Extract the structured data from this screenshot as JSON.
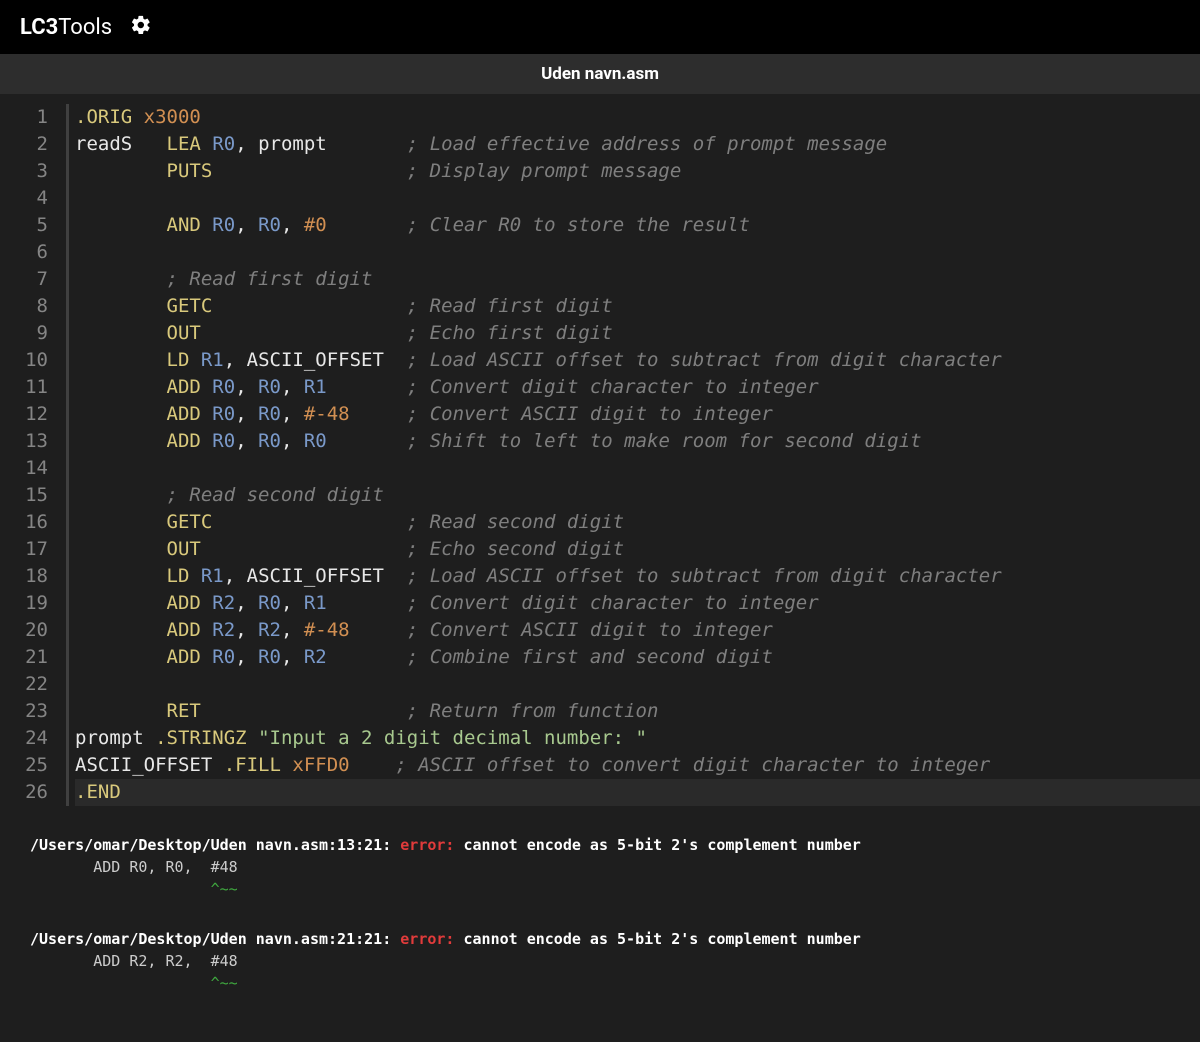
{
  "app": {
    "title_bold": "LC3",
    "title_rest": "Tools"
  },
  "tab": {
    "filename": "Uden navn.asm"
  },
  "editor": {
    "line_count": 26,
    "active_line": 26,
    "lines": [
      [
        {
          "cls": "tk-directive",
          "t": ".ORIG"
        },
        {
          "cls": "",
          "t": " "
        },
        {
          "cls": "tk-number",
          "t": "x3000"
        }
      ],
      [
        {
          "cls": "tk-label",
          "t": "readS"
        },
        {
          "cls": "",
          "t": "   "
        },
        {
          "cls": "tk-opcode",
          "t": "LEA"
        },
        {
          "cls": "",
          "t": " "
        },
        {
          "cls": "tk-register",
          "t": "R0"
        },
        {
          "cls": "tk-punct",
          "t": ", "
        },
        {
          "cls": "tk-label",
          "t": "prompt"
        },
        {
          "cls": "",
          "t": "       "
        },
        {
          "cls": "tk-comment",
          "t": "; Load effective address of prompt message"
        }
      ],
      [
        {
          "cls": "",
          "t": "        "
        },
        {
          "cls": "tk-opcode",
          "t": "PUTS"
        },
        {
          "cls": "",
          "t": "                 "
        },
        {
          "cls": "tk-comment",
          "t": "; Display prompt message"
        }
      ],
      [],
      [
        {
          "cls": "",
          "t": "        "
        },
        {
          "cls": "tk-opcode",
          "t": "AND"
        },
        {
          "cls": "",
          "t": " "
        },
        {
          "cls": "tk-register",
          "t": "R0"
        },
        {
          "cls": "tk-punct",
          "t": ", "
        },
        {
          "cls": "tk-register",
          "t": "R0"
        },
        {
          "cls": "tk-punct",
          "t": ", "
        },
        {
          "cls": "tk-number",
          "t": "#0"
        },
        {
          "cls": "",
          "t": "       "
        },
        {
          "cls": "tk-comment",
          "t": "; Clear R0 to store the result"
        }
      ],
      [],
      [
        {
          "cls": "",
          "t": "        "
        },
        {
          "cls": "tk-comment",
          "t": "; Read first digit"
        }
      ],
      [
        {
          "cls": "",
          "t": "        "
        },
        {
          "cls": "tk-opcode",
          "t": "GETC"
        },
        {
          "cls": "",
          "t": "                 "
        },
        {
          "cls": "tk-comment",
          "t": "; Read first digit"
        }
      ],
      [
        {
          "cls": "",
          "t": "        "
        },
        {
          "cls": "tk-opcode",
          "t": "OUT"
        },
        {
          "cls": "",
          "t": "                  "
        },
        {
          "cls": "tk-comment",
          "t": "; Echo first digit"
        }
      ],
      [
        {
          "cls": "",
          "t": "        "
        },
        {
          "cls": "tk-opcode",
          "t": "LD"
        },
        {
          "cls": "",
          "t": " "
        },
        {
          "cls": "tk-register",
          "t": "R1"
        },
        {
          "cls": "tk-punct",
          "t": ", "
        },
        {
          "cls": "tk-label",
          "t": "ASCII_OFFSET"
        },
        {
          "cls": "",
          "t": "  "
        },
        {
          "cls": "tk-comment",
          "t": "; Load ASCII offset to subtract from digit character"
        }
      ],
      [
        {
          "cls": "",
          "t": "        "
        },
        {
          "cls": "tk-opcode",
          "t": "ADD"
        },
        {
          "cls": "",
          "t": " "
        },
        {
          "cls": "tk-register",
          "t": "R0"
        },
        {
          "cls": "tk-punct",
          "t": ", "
        },
        {
          "cls": "tk-register",
          "t": "R0"
        },
        {
          "cls": "tk-punct",
          "t": ", "
        },
        {
          "cls": "tk-register",
          "t": "R1"
        },
        {
          "cls": "",
          "t": "       "
        },
        {
          "cls": "tk-comment",
          "t": "; Convert digit character to integer"
        }
      ],
      [
        {
          "cls": "",
          "t": "        "
        },
        {
          "cls": "tk-opcode",
          "t": "ADD"
        },
        {
          "cls": "",
          "t": " "
        },
        {
          "cls": "tk-register",
          "t": "R0"
        },
        {
          "cls": "tk-punct",
          "t": ", "
        },
        {
          "cls": "tk-register",
          "t": "R0"
        },
        {
          "cls": "tk-punct",
          "t": ", "
        },
        {
          "cls": "tk-number",
          "t": "#-48"
        },
        {
          "cls": "",
          "t": "     "
        },
        {
          "cls": "tk-comment",
          "t": "; Convert ASCII digit to integer"
        }
      ],
      [
        {
          "cls": "",
          "t": "        "
        },
        {
          "cls": "tk-opcode",
          "t": "ADD"
        },
        {
          "cls": "",
          "t": " "
        },
        {
          "cls": "tk-register",
          "t": "R0"
        },
        {
          "cls": "tk-punct",
          "t": ", "
        },
        {
          "cls": "tk-register",
          "t": "R0"
        },
        {
          "cls": "tk-punct",
          "t": ", "
        },
        {
          "cls": "tk-register",
          "t": "R0"
        },
        {
          "cls": "",
          "t": "       "
        },
        {
          "cls": "tk-comment",
          "t": "; Shift to left to make room for second digit"
        }
      ],
      [],
      [
        {
          "cls": "",
          "t": "        "
        },
        {
          "cls": "tk-comment",
          "t": "; Read second digit"
        }
      ],
      [
        {
          "cls": "",
          "t": "        "
        },
        {
          "cls": "tk-opcode",
          "t": "GETC"
        },
        {
          "cls": "",
          "t": "                 "
        },
        {
          "cls": "tk-comment",
          "t": "; Read second digit"
        }
      ],
      [
        {
          "cls": "",
          "t": "        "
        },
        {
          "cls": "tk-opcode",
          "t": "OUT"
        },
        {
          "cls": "",
          "t": "                  "
        },
        {
          "cls": "tk-comment",
          "t": "; Echo second digit"
        }
      ],
      [
        {
          "cls": "",
          "t": "        "
        },
        {
          "cls": "tk-opcode",
          "t": "LD"
        },
        {
          "cls": "",
          "t": " "
        },
        {
          "cls": "tk-register",
          "t": "R1"
        },
        {
          "cls": "tk-punct",
          "t": ", "
        },
        {
          "cls": "tk-label",
          "t": "ASCII_OFFSET"
        },
        {
          "cls": "",
          "t": "  "
        },
        {
          "cls": "tk-comment",
          "t": "; Load ASCII offset to subtract from digit character"
        }
      ],
      [
        {
          "cls": "",
          "t": "        "
        },
        {
          "cls": "tk-opcode",
          "t": "ADD"
        },
        {
          "cls": "",
          "t": " "
        },
        {
          "cls": "tk-register",
          "t": "R2"
        },
        {
          "cls": "tk-punct",
          "t": ", "
        },
        {
          "cls": "tk-register",
          "t": "R0"
        },
        {
          "cls": "tk-punct",
          "t": ", "
        },
        {
          "cls": "tk-register",
          "t": "R1"
        },
        {
          "cls": "",
          "t": "       "
        },
        {
          "cls": "tk-comment",
          "t": "; Convert digit character to integer"
        }
      ],
      [
        {
          "cls": "",
          "t": "        "
        },
        {
          "cls": "tk-opcode",
          "t": "ADD"
        },
        {
          "cls": "",
          "t": " "
        },
        {
          "cls": "tk-register",
          "t": "R2"
        },
        {
          "cls": "tk-punct",
          "t": ", "
        },
        {
          "cls": "tk-register",
          "t": "R2"
        },
        {
          "cls": "tk-punct",
          "t": ", "
        },
        {
          "cls": "tk-number",
          "t": "#-48"
        },
        {
          "cls": "",
          "t": "     "
        },
        {
          "cls": "tk-comment",
          "t": "; Convert ASCII digit to integer"
        }
      ],
      [
        {
          "cls": "",
          "t": "        "
        },
        {
          "cls": "tk-opcode",
          "t": "ADD"
        },
        {
          "cls": "",
          "t": " "
        },
        {
          "cls": "tk-register",
          "t": "R0"
        },
        {
          "cls": "tk-punct",
          "t": ", "
        },
        {
          "cls": "tk-register",
          "t": "R0"
        },
        {
          "cls": "tk-punct",
          "t": ", "
        },
        {
          "cls": "tk-register",
          "t": "R2"
        },
        {
          "cls": "",
          "t": "       "
        },
        {
          "cls": "tk-comment",
          "t": "; Combine first and second digit"
        }
      ],
      [],
      [
        {
          "cls": "",
          "t": "        "
        },
        {
          "cls": "tk-opcode",
          "t": "RET"
        },
        {
          "cls": "",
          "t": "                  "
        },
        {
          "cls": "tk-comment",
          "t": "; Return from function"
        }
      ],
      [
        {
          "cls": "tk-label",
          "t": "prompt"
        },
        {
          "cls": "",
          "t": " "
        },
        {
          "cls": "tk-directive",
          "t": ".STRINGZ"
        },
        {
          "cls": "",
          "t": " "
        },
        {
          "cls": "tk-string",
          "t": "\"Input a 2 digit decimal number: \""
        }
      ],
      [
        {
          "cls": "tk-label",
          "t": "ASCII_OFFSET"
        },
        {
          "cls": "",
          "t": " "
        },
        {
          "cls": "tk-directive",
          "t": ".FILL"
        },
        {
          "cls": "",
          "t": " "
        },
        {
          "cls": "tk-number",
          "t": "xFFD0"
        },
        {
          "cls": "",
          "t": "    "
        },
        {
          "cls": "tk-comment",
          "t": "; ASCII offset to convert digit character to integer"
        }
      ],
      [
        {
          "cls": "tk-directive",
          "t": ".END"
        }
      ]
    ]
  },
  "console": {
    "errors": [
      {
        "path": "/Users/omar/Desktop/Uden navn.asm:13:21: ",
        "tag": "error: ",
        "msg": "cannot encode as 5-bit 2's complement number",
        "code": "       ADD R0, R0,  #48",
        "caret": "                    ^~~"
      },
      {
        "path": "/Users/omar/Desktop/Uden navn.asm:21:21: ",
        "tag": "error: ",
        "msg": "cannot encode as 5-bit 2's complement number",
        "code": "       ADD R2, R2,  #48",
        "caret": "                    ^~~"
      }
    ]
  }
}
